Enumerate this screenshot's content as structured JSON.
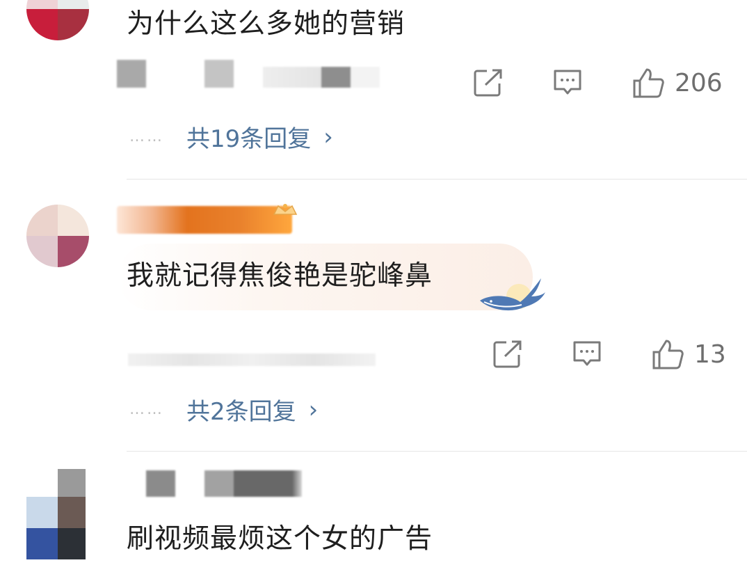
{
  "comments": [
    {
      "text": "为什么这么多她的营销",
      "likes": "206",
      "replies_label": "共19条回复"
    },
    {
      "text": "我就记得焦俊艳是驼峰鼻",
      "likes": "13",
      "replies_label": "共2条回复"
    },
    {
      "text": "刷视频最烦这个女的广告"
    }
  ],
  "replies_dots": "……",
  "replies_chevron": "›",
  "icons": {
    "share": "share-icon",
    "comment": "comment-icon",
    "like": "like-icon"
  },
  "colors": {
    "reply_link": "#50749a",
    "icon_gray": "#7a7a7a",
    "text": "#1e1e1e",
    "divider": "#e6e6e6"
  }
}
